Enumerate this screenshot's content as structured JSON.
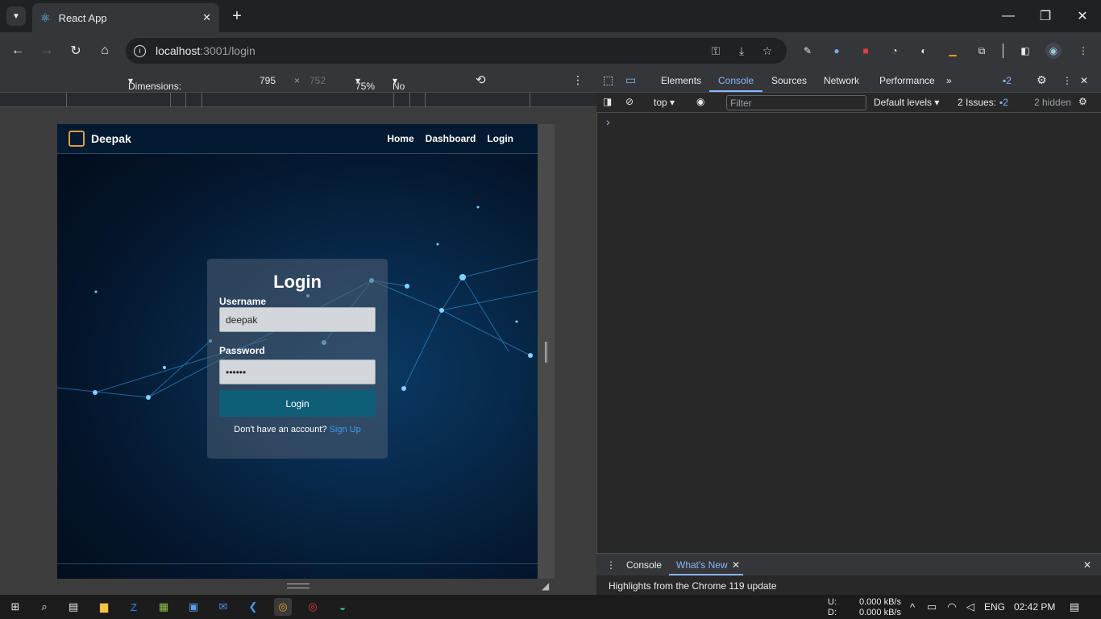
{
  "browser": {
    "tab_title": "React App",
    "url_host": "localhost",
    "url_path": ":3001/login"
  },
  "device_toolbar": {
    "dimensions": "Dimensions: Responsive",
    "width": "795",
    "times": "×",
    "height": "752",
    "zoom": "75%",
    "throttling": "No throttling"
  },
  "app": {
    "brand": "Deepak",
    "nav": [
      "Home",
      "Dashboard",
      "Login"
    ],
    "login_title": "Login",
    "username_label": "Username",
    "username_value": "deepak",
    "password_label": "Password",
    "password_value": "••••••",
    "login_button": "Login",
    "no_account_text": "Don't have an account?",
    "signup_link": "Sign Up"
  },
  "devtools": {
    "tabs": [
      "Elements",
      "Console",
      "Sources",
      "Network",
      "Performance"
    ],
    "active_tab": "Console",
    "issues_badge": "2",
    "context": "top",
    "filter_placeholder": "Filter",
    "levels": "Default levels",
    "issues_label": "2 Issues:",
    "issues_count": "2",
    "hidden": "2 hidden",
    "prompt": "›",
    "drawer_tabs": [
      "Console",
      "What's New"
    ],
    "drawer_text": "Highlights from the Chrome 119 update"
  },
  "taskbar": {
    "net_up_label": "U:",
    "net_up": "0.000 kB/s",
    "net_down_label": "D:",
    "net_down": "0.000 kB/s",
    "lang": "ENG",
    "time": "02:42 PM"
  },
  "colors": {
    "accent_blue": "#8ab4f8",
    "signup_link": "#3b9be8",
    "login_button": "#0f5e78"
  }
}
